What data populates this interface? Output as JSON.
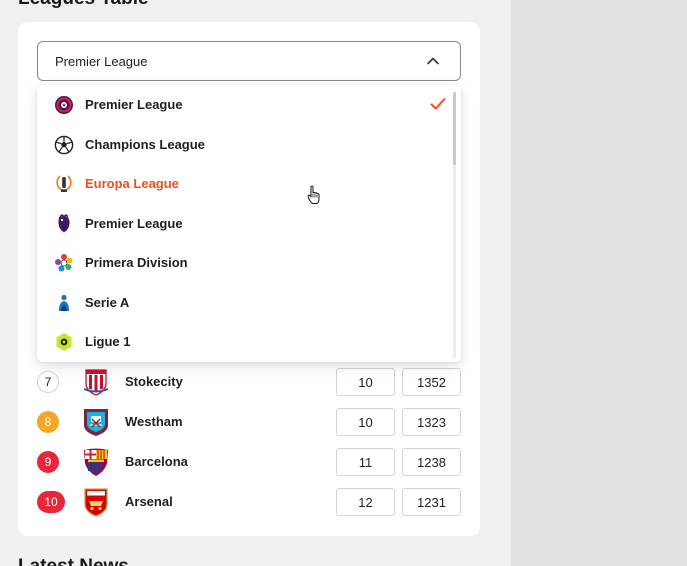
{
  "page": {
    "title": "Leagues Table",
    "next_title": "Latest News"
  },
  "select": {
    "value": "Premier League",
    "expanded": true
  },
  "dropdown": {
    "selected_index": 0,
    "hover_index": 2,
    "items": [
      {
        "label": "Premier League",
        "icon": "premier-league-logo-icon"
      },
      {
        "label": "Champions League",
        "icon": "soccer-ball-icon"
      },
      {
        "label": "Europa League",
        "icon": "europa-league-trophy-icon"
      },
      {
        "label": "Premier League",
        "icon": "premier-lion-icon"
      },
      {
        "label": "Primera Division",
        "icon": "laliga-logo-icon"
      },
      {
        "label": "Serie A",
        "icon": "serie-a-logo-icon"
      },
      {
        "label": "Ligue 1",
        "icon": "ligue-1-logo-icon"
      }
    ]
  },
  "table": {
    "rows": [
      {
        "rank": "7",
        "team": "Stokecity",
        "played": "10",
        "points": "1352",
        "rank_color": "",
        "crest": "stoke-crest-icon"
      },
      {
        "rank": "8",
        "team": "Westham",
        "played": "10",
        "points": "1323",
        "rank_color": "#f5a623",
        "crest": "westham-crest-icon"
      },
      {
        "rank": "9",
        "team": "Barcelona",
        "played": "11",
        "points": "1238",
        "rank_color": "#e8253a",
        "crest": "barcelona-crest-icon"
      },
      {
        "rank": "10",
        "team": "Arsenal",
        "played": "12",
        "points": "1231",
        "rank_color": "#e8253a",
        "crest": "arsenal-crest-icon"
      }
    ]
  },
  "colors": {
    "accent": "#e8531f",
    "check": "#e8531f",
    "rank_orange": "#f5a623",
    "rank_red": "#e8253a"
  }
}
